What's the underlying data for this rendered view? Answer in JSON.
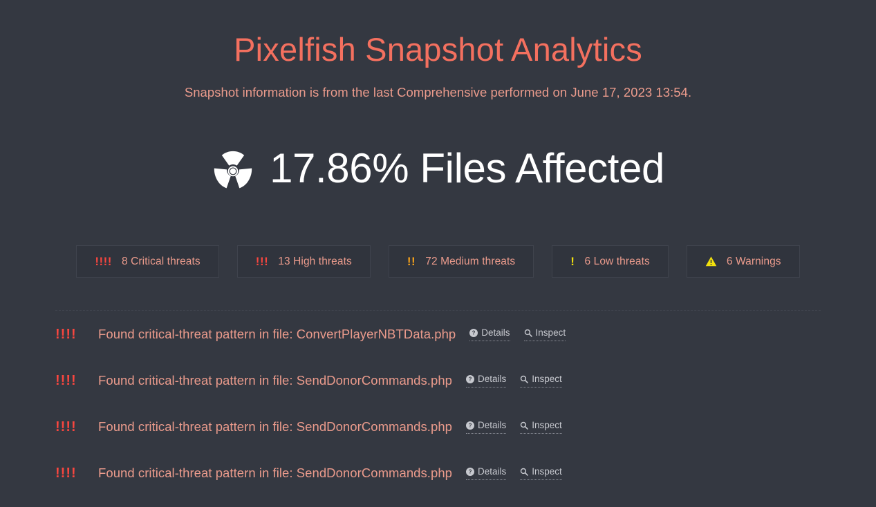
{
  "header": {
    "title": "Pixelfish Snapshot Analytics",
    "subtitle": "Snapshot information is from the last Comprehensive performed on June 17, 2023 13:54."
  },
  "hero": {
    "icon": "radiation-icon",
    "text": "17.86% Files Affected",
    "percent": "17.86%"
  },
  "badges": [
    {
      "marks": "!!!!",
      "severity": "critical",
      "label": "8 Critical threats",
      "count": 8,
      "color": "#f8463f",
      "icon": "exclamation-marks-icon"
    },
    {
      "marks": "!!!",
      "severity": "high",
      "label": "13 High threats",
      "count": 13,
      "color": "#f8463f",
      "icon": "exclamation-marks-icon"
    },
    {
      "marks": "!!",
      "severity": "medium",
      "label": "72 Medium threats",
      "count": 72,
      "color": "#f5a11a",
      "icon": "exclamation-marks-icon"
    },
    {
      "marks": "!",
      "severity": "low",
      "label": "6 Low threats",
      "count": 6,
      "color": "#f2e00d",
      "icon": "exclamation-marks-icon"
    },
    {
      "marks": "",
      "severity": "warning",
      "label": "6 Warnings",
      "count": 6,
      "color": "#f2e00d",
      "icon": "warning-triangle-icon"
    }
  ],
  "findings": {
    "details_label": "Details",
    "inspect_label": "Inspect",
    "rows": [
      {
        "marks": "!!!!",
        "severity": "critical",
        "text": "Found critical-threat pattern in file: ConvertPlayerNBTData.php",
        "file": "ConvertPlayerNBTData.php"
      },
      {
        "marks": "!!!!",
        "severity": "critical",
        "text": "Found critical-threat pattern in file: SendDonorCommands.php",
        "file": "SendDonorCommands.php"
      },
      {
        "marks": "!!!!",
        "severity": "critical",
        "text": "Found critical-threat pattern in file: SendDonorCommands.php",
        "file": "SendDonorCommands.php"
      },
      {
        "marks": "!!!!",
        "severity": "critical",
        "text": "Found critical-threat pattern in file: SendDonorCommands.php",
        "file": "SendDonorCommands.php"
      }
    ]
  },
  "theme": {
    "background": "#343841",
    "title_color": "#f4705f",
    "body_color": "#eb9b8c",
    "hero_color": "#ffffff",
    "badge_fill": "#30343d",
    "badge_border": "#3f434d",
    "link_color": "#c7c9cf"
  }
}
